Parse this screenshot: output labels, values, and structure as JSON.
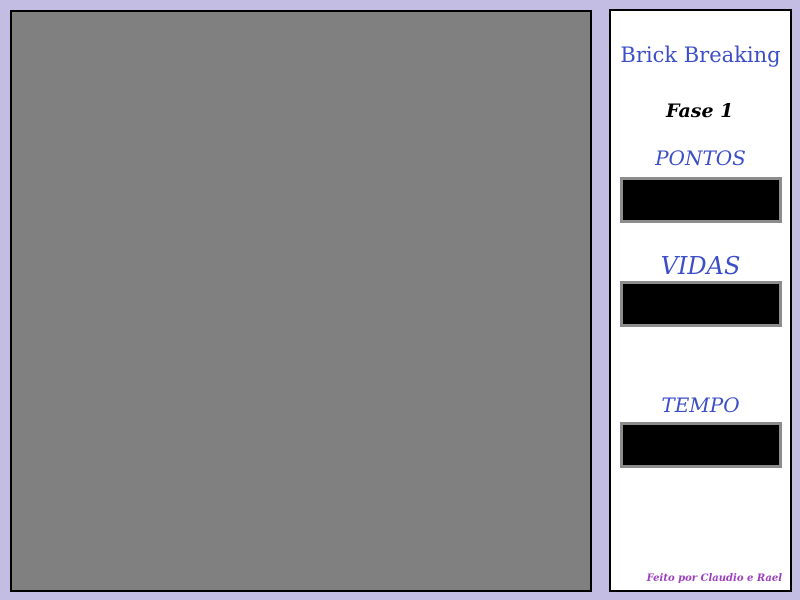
{
  "game": {
    "title": "Brick Breaking",
    "level_label": "Fase 1",
    "stats": {
      "points_label": "PONTOS",
      "points_value": "",
      "lives_label": "VIDAS",
      "lives_value": "",
      "time_label": "TEMPO",
      "time_value": ""
    },
    "credits": "Feito por Claudio e Rael"
  },
  "colors": {
    "background": "#c3bde3",
    "board": "#808080",
    "panel": "#ffffff",
    "accent": "#3d4fc7",
    "credits": "#9c3fbf"
  }
}
